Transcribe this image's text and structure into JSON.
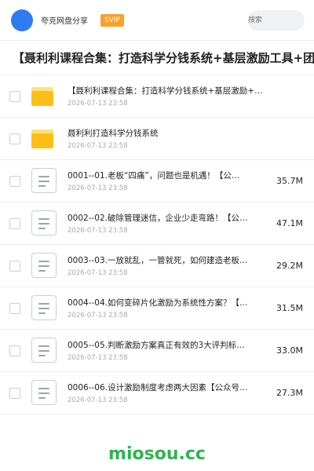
{
  "header": {
    "brand": "夸克网盘分享",
    "badge": "SVIP",
    "search_placeholder": "搜索"
  },
  "title": "【聂利利课程合集：打造科学分钱系统+基层激励工具+团队",
  "items": [
    {
      "type": "folder",
      "name": "【聂利利课程合集：打造科学分钱系统+基层激励+…",
      "date": "2026-07-13 23:58",
      "size": ""
    },
    {
      "type": "folder",
      "name": "聂利利打造科学分钱系统",
      "date": "2026-07-13 23:58",
      "size": ""
    },
    {
      "type": "file",
      "name": "0001--01.老板“四痛”，问题也是机遇！【公…",
      "date": "2026-07-13 23:58",
      "size": "35.7M"
    },
    {
      "type": "file",
      "name": "0002--02.破除管理迷信，企业少走弯路！【公…",
      "date": "2026-07-13 23:58",
      "size": "47.1M"
    },
    {
      "type": "file",
      "name": "0003--03.一放就乱，一管就死，如何建造老板…",
      "date": "2026-07-13 23:58",
      "size": "29.2M"
    },
    {
      "type": "file",
      "name": "0004--04.如何变碎片化激励为系统性方案？【…",
      "date": "2026-07-13 23:58",
      "size": "31.5M"
    },
    {
      "type": "file",
      "name": "0005--05.判断激励方案真正有效的3大评判标…",
      "date": "2026-07-13 23:58",
      "size": "33.0M"
    },
    {
      "type": "file",
      "name": "0006--06.设计激励制度考虑两大因素【公众号…",
      "date": "2026-07-13 23:58",
      "size": "27.3M"
    }
  ],
  "watermark": "miosou.cc"
}
